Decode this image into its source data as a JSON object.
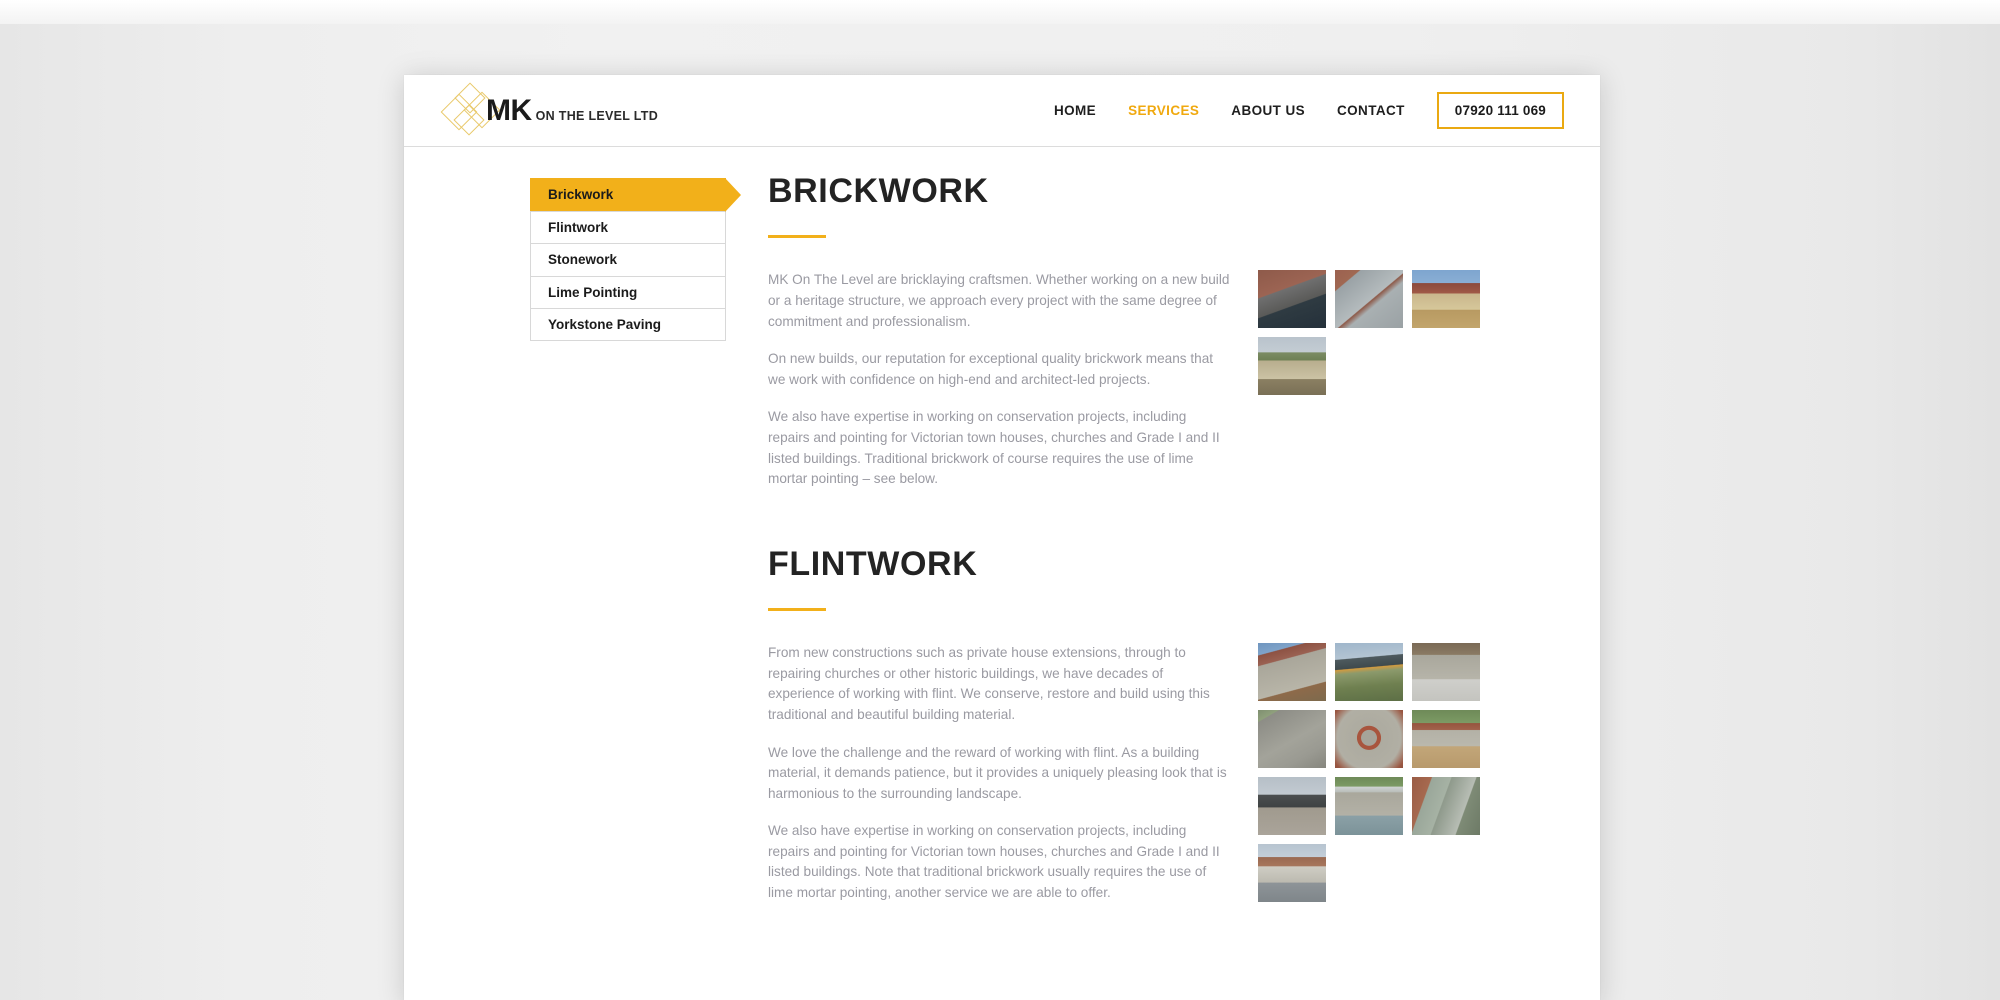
{
  "header": {
    "logo": {
      "mark_name": "mk-diamond-logo",
      "initials": "MK",
      "tagline": "ON THE LEVEL LTD"
    },
    "nav": [
      {
        "label": "HOME",
        "active": false
      },
      {
        "label": "SERVICES",
        "active": true
      },
      {
        "label": "ABOUT US",
        "active": false
      },
      {
        "label": "CONTACT",
        "active": false
      }
    ],
    "phone": "07920 111 069"
  },
  "sidebar": {
    "items": [
      {
        "label": "Brickwork",
        "active": true
      },
      {
        "label": "Flintwork",
        "active": false
      },
      {
        "label": "Stonework",
        "active": false
      },
      {
        "label": "Lime Pointing",
        "active": false
      },
      {
        "label": "Yorkstone Paving",
        "active": false
      }
    ]
  },
  "sections": [
    {
      "title": "BRICKWORK",
      "paragraphs": [
        "MK On The Level are bricklaying craftsmen. Whether working on a new build or a heritage structure, we approach every project with the same degree of commitment and professionalism.",
        "On new builds, our reputation for exceptional quality brickwork means that we work with confidence on high-end and architect-led projects.",
        "We also have expertise in working on conservation projects, including repairs and pointing for Victorian town houses, churches and Grade I and II listed buildings. Traditional brickwork of course requires the use of lime mortar pointing – see below."
      ],
      "gallery": [
        "brickwork-photo-steps-and-wall",
        "brickwork-photo-paving-and-brick-detail",
        "brickwork-photo-flint-and-brick-building",
        "brickwork-photo-curved-garden-wall"
      ]
    },
    {
      "title": "FLINTWORK",
      "paragraphs": [
        "From new constructions such as private house extensions, through to repairing churches or other historic buildings, we have decades of experience of working with flint. We conserve, restore and build using this traditional and beautiful building material.",
        "We love the challenge and the reward of working with flint. As a building material, it demands patience, but it provides a uniquely pleasing look that is harmonious to the surrounding landscape.",
        "We also have expertise in working on conservation projects, including repairs and pointing for Victorian town houses, churches and Grade I and II listed buildings. Note that traditional brickwork usually requires the use of lime mortar pointing, another service we are able to offer."
      ],
      "gallery": [
        "flintwork-photo-flint-panel-brick-frame",
        "flintwork-photo-modern-barn-building",
        "flintwork-photo-flint-wall-with-window",
        "flintwork-photo-flint-wall-corner",
        "flintwork-photo-flint-roundel-detail",
        "flintwork-photo-curved-flint-garden-wall",
        "flintwork-photo-building-under-construction",
        "flintwork-photo-flint-wall-by-pool",
        "flintwork-photo-flint-wall-with-steps",
        "flintwork-photo-flint-wall-with-railings"
      ]
    }
  ],
  "colors": {
    "accent_gold": "#F2B01A",
    "accent_gold_border": "#EAA911",
    "nav_active": "#F0A90F",
    "heading": "#232323",
    "body_text": "#9A9AA2",
    "logo_diamond": "#E9C96A"
  }
}
